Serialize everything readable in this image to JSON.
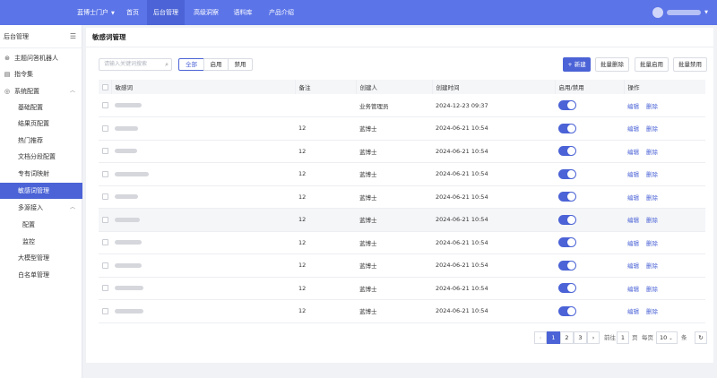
{
  "topbar": {
    "brand": "蓝博士门户",
    "nav": [
      "首页",
      "后台管理",
      "高级洞察",
      "语料库",
      "产品介绍"
    ],
    "active_nav": "后台管理"
  },
  "sidebar": {
    "title": "后台管理",
    "items": [
      {
        "label": "主题问答机器人",
        "icon": "robot-icon"
      },
      {
        "label": "指令集",
        "icon": "instruction-icon"
      },
      {
        "label": "系统配置",
        "icon": "settings-icon",
        "expanded": true
      },
      {
        "label": "基础配置"
      },
      {
        "label": "结果页配置"
      },
      {
        "label": "热门推荐"
      },
      {
        "label": "文档分段配置"
      },
      {
        "label": "专有词映射"
      },
      {
        "label": "敏感词管理",
        "active": true
      },
      {
        "label": "多源接入",
        "expanded": true
      },
      {
        "label": "配置"
      },
      {
        "label": "监控"
      },
      {
        "label": "大模型管理"
      },
      {
        "label": "白名单管理"
      }
    ]
  },
  "page": {
    "title": "敏感词管理",
    "search_placeholder": "请输入关键词搜索",
    "filters": [
      "全部",
      "启用",
      "禁用"
    ],
    "active_filter": "全部",
    "buttons": {
      "add": "+ 新建",
      "batch_delete": "批量删除",
      "batch_enable": "批量启用",
      "batch_disable": "批量禁用"
    }
  },
  "table": {
    "columns": [
      "敏感词",
      "备注",
      "创建人",
      "创建时间",
      "启用/禁用",
      "操作"
    ],
    "action_edit": "编辑",
    "action_delete": "删除",
    "rows": [
      {
        "remark": "",
        "creator": "业务管理员",
        "time": "2024-12-23 09:37",
        "enabled": true
      },
      {
        "remark": "12",
        "creator": "蓝博士",
        "time": "2024-06-21 10:54",
        "enabled": true
      },
      {
        "remark": "12",
        "creator": "蓝博士",
        "time": "2024-06-21 10:54",
        "enabled": true
      },
      {
        "remark": "12",
        "creator": "蓝博士",
        "time": "2024-06-21 10:54",
        "enabled": true
      },
      {
        "remark": "12",
        "creator": "蓝博士",
        "time": "2024-06-21 10:54",
        "enabled": true
      },
      {
        "remark": "12",
        "creator": "蓝博士",
        "time": "2024-06-21 10:54",
        "enabled": true
      },
      {
        "remark": "12",
        "creator": "蓝博士",
        "time": "2024-06-21 10:54",
        "enabled": true
      },
      {
        "remark": "12",
        "creator": "蓝博士",
        "time": "2024-06-21 10:54",
        "enabled": true
      },
      {
        "remark": "12",
        "creator": "蓝博士",
        "time": "2024-06-21 10:54",
        "enabled": true
      },
      {
        "remark": "12",
        "creator": "蓝博士",
        "time": "2024-06-21 10:54",
        "enabled": true
      }
    ]
  },
  "pagination": {
    "prev": "‹",
    "pages": [
      "1",
      "2",
      "3"
    ],
    "current": "1",
    "next": "›",
    "goto_prefix": "前往",
    "goto_value": "1",
    "goto_suffix": "页",
    "per_page_prefix": "每页",
    "per_page_value": "10",
    "per_page_suffix": "条"
  },
  "colors": {
    "primary": "#4b63d6",
    "topbar": "#5b74e8"
  }
}
